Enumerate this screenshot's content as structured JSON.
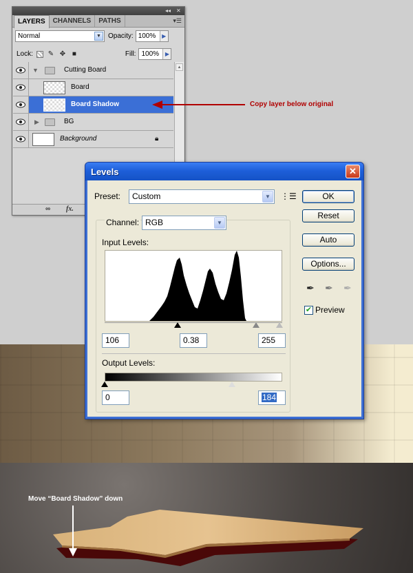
{
  "layers_panel": {
    "tabs": [
      "LAYERS",
      "CHANNELS",
      "PATHS"
    ],
    "active_tab": "LAYERS",
    "blend_mode": "Normal",
    "opacity_label": "Opacity:",
    "opacity_value": "100%",
    "lock_label": "Lock:",
    "fill_label": "Fill:",
    "fill_value": "100%",
    "layers": [
      {
        "name": "Cutting Board",
        "kind": "group",
        "expanded": true,
        "visible": true,
        "selected": false
      },
      {
        "name": "Board",
        "kind": "layer",
        "visible": true,
        "selected": false
      },
      {
        "name": "Board Shadow",
        "kind": "layer",
        "visible": true,
        "selected": true
      },
      {
        "name": "BG",
        "kind": "group",
        "expanded": false,
        "visible": true,
        "selected": false
      },
      {
        "name": "Background",
        "kind": "background",
        "visible": true,
        "selected": false,
        "locked": true
      }
    ],
    "bottom_icons": [
      "link-icon",
      "fx-icon"
    ]
  },
  "annotations": {
    "copy_note": "Copy layer below original",
    "move_note": "Move “Board Shadow” down",
    "arrow_color": "#b00000"
  },
  "levels_dialog": {
    "title": "Levels",
    "preset_label": "Preset:",
    "preset_value": "Custom",
    "channel_label": "Channel:",
    "channel_value": "RGB",
    "input_levels_label": "Input Levels:",
    "input_black": "106",
    "input_gamma": "0.38",
    "input_white": "255",
    "output_levels_label": "Output Levels:",
    "output_black": "0",
    "output_white": "184",
    "buttons": {
      "ok": "OK",
      "reset": "Reset",
      "auto": "Auto",
      "options": "Options..."
    },
    "preview_label": "Preview",
    "preview_checked": true,
    "accent_color": "#3c6fd4"
  }
}
